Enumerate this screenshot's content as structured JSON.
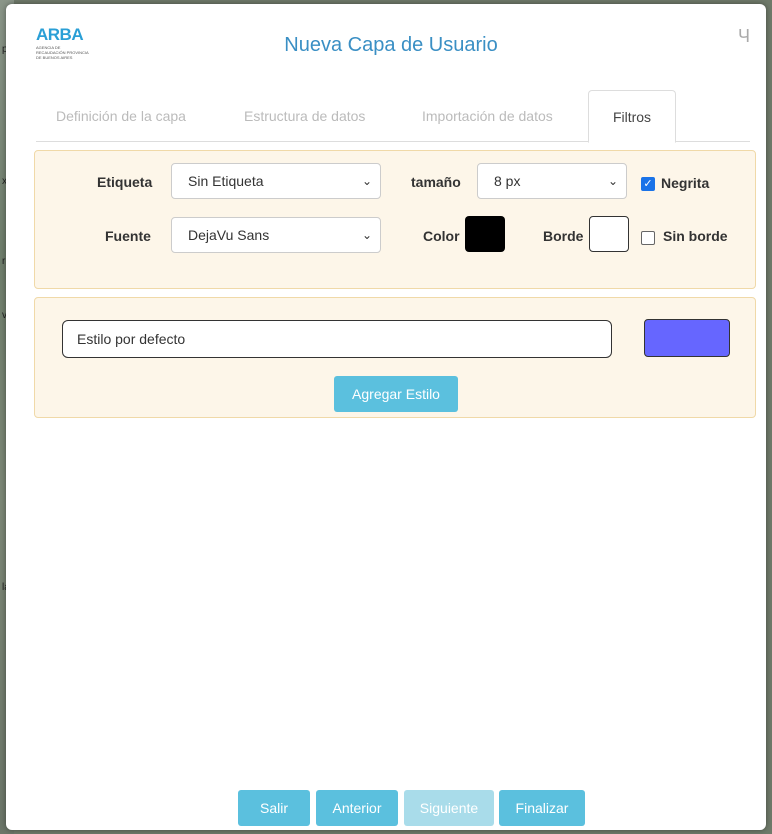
{
  "map_labels": [
    "p",
    "x",
    "r",
    "v",
    "la"
  ],
  "dialog": {
    "logo": {
      "text": "ARBA",
      "subtitle": "AGENCIA DE RECAUDACIÓN PROVINCIA DE BUENOS AIRES"
    },
    "title": "Nueva Capa de Usuario",
    "close_label": "Ч"
  },
  "tabs": [
    {
      "label": "Definición de la capa",
      "active": false
    },
    {
      "label": "Estructura de datos",
      "active": false
    },
    {
      "label": "Importación de datos",
      "active": false
    },
    {
      "label": "Filtros",
      "active": true
    }
  ],
  "label_panel": {
    "etiqueta_label": "Etiqueta",
    "etiqueta_value": "Sin Etiqueta",
    "tamano_label": "tamaño",
    "tamano_value": "8 px",
    "negrita_label": "Negrita",
    "negrita_checked": true,
    "fuente_label": "Fuente",
    "fuente_value": "DejaVu Sans",
    "color_label": "Color",
    "color_value": "#000000",
    "borde_label": "Borde",
    "borde_value": "#ffffff",
    "sin_borde_label": "Sin borde",
    "sin_borde_checked": false
  },
  "style_panel": {
    "style_name": "Estilo por defecto",
    "style_color": "#6666ff",
    "add_style_label": "Agregar Estilo"
  },
  "footer": {
    "salir": "Salir",
    "anterior": "Anterior",
    "siguiente": "Siguiente",
    "finalizar": "Finalizar"
  }
}
